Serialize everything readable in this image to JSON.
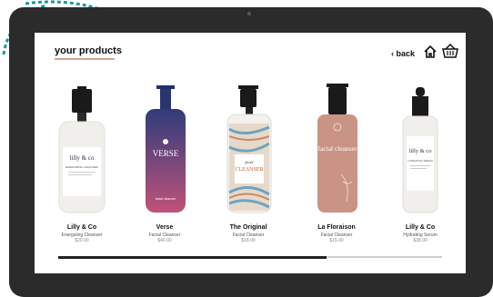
{
  "page": {
    "title": "your products"
  },
  "nav": {
    "back_label": "back",
    "home_icon": "home-icon",
    "basket_icon": "basket-icon"
  },
  "products": [
    {
      "brand": "Lilly & Co",
      "type": "Energizing Cleanser",
      "price": "$20.00",
      "label_text": "lilly & co",
      "label_small": "ENERGIZING CLEANSER",
      "colors": {
        "bottle": "#f1efeb",
        "cap": "#1a1a1a",
        "label": "#ffffff"
      }
    },
    {
      "brand": "Verse",
      "type": "Facial Cleanser",
      "price": "$40.00",
      "label_text": "VERSE",
      "label_small": "facial cleanser",
      "colors": {
        "bottle_top": "#2f3c7a",
        "bottle_bottom": "#c0527a",
        "cap": "#223168"
      }
    },
    {
      "brand": "The Original",
      "type": "Facial Cleanser",
      "price": "$18.00",
      "label_text": "CLEANSER",
      "label_small": "facial",
      "colors": {
        "bottle": "#f3f1ee",
        "cap": "#1a1a1a"
      }
    },
    {
      "brand": "La Floraison",
      "type": "Facial Cleanser",
      "price": "$15.00",
      "label_text": "facial cleanser",
      "label_small": "",
      "colors": {
        "bottle": "#c99484",
        "cap": "#1a1a1a"
      }
    },
    {
      "brand": "Lilly & Co",
      "type": "Hydrating Serum",
      "price": "$38.00",
      "label_text": "lilly & co",
      "label_small": "HYDRATING SERUM",
      "colors": {
        "bottle": "#f1efeb",
        "cap": "#1a1a1a"
      }
    }
  ],
  "scroll": {
    "fraction": 0.7
  },
  "colors": {
    "accent": "#d7a28f",
    "frame": "#2b2b2b",
    "swirl": "#1a9a9a"
  }
}
